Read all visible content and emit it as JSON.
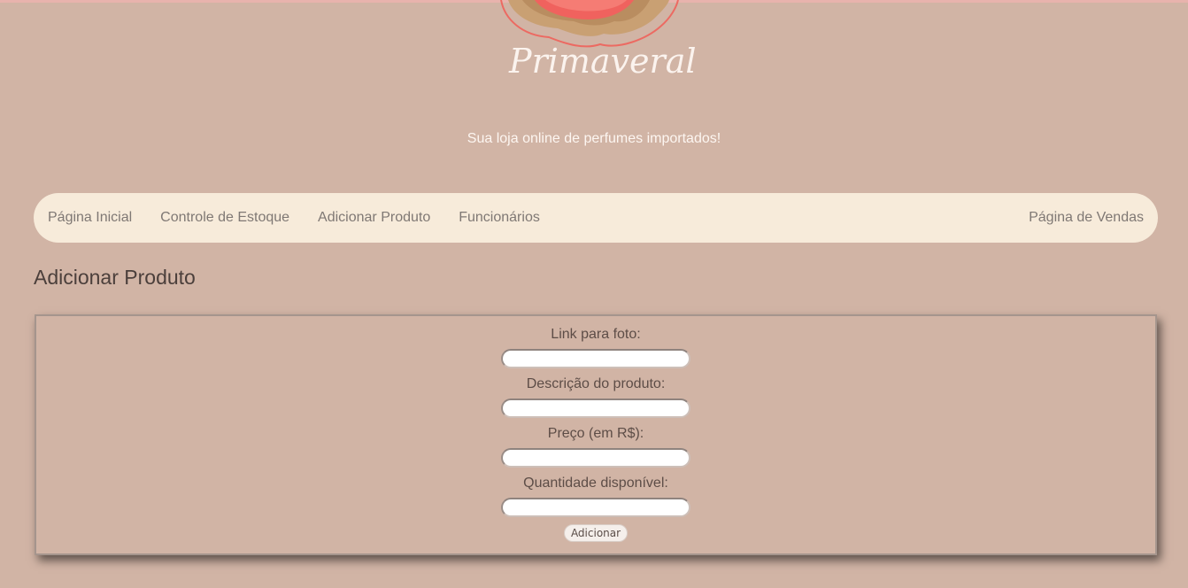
{
  "brand": {
    "name": "Primaveral",
    "tagline": "Sua loja online de perfumes importados!",
    "logo_icon": "flower-logo-icon"
  },
  "nav": {
    "items": [
      {
        "label": "Página Inicial"
      },
      {
        "label": "Controle de Estoque"
      },
      {
        "label": "Adicionar Produto"
      },
      {
        "label": "Funcionários"
      }
    ],
    "right_item": {
      "label": "Página de Vendas"
    }
  },
  "page": {
    "title": "Adicionar Produto"
  },
  "form": {
    "fields": [
      {
        "label": "Link para foto:",
        "value": "",
        "placeholder": ""
      },
      {
        "label": "Descrição do produto:",
        "value": "",
        "placeholder": ""
      },
      {
        "label": "Preço (em R$):",
        "value": "",
        "placeholder": ""
      },
      {
        "label": "Quantidade disponível:",
        "value": "",
        "placeholder": ""
      }
    ],
    "submit_label": "Adicionar"
  },
  "colors": {
    "background": "#d1b4a5",
    "navbar": "#f7ebda",
    "accent_red": "#f0625e",
    "accent_gold": "#c9a073"
  }
}
